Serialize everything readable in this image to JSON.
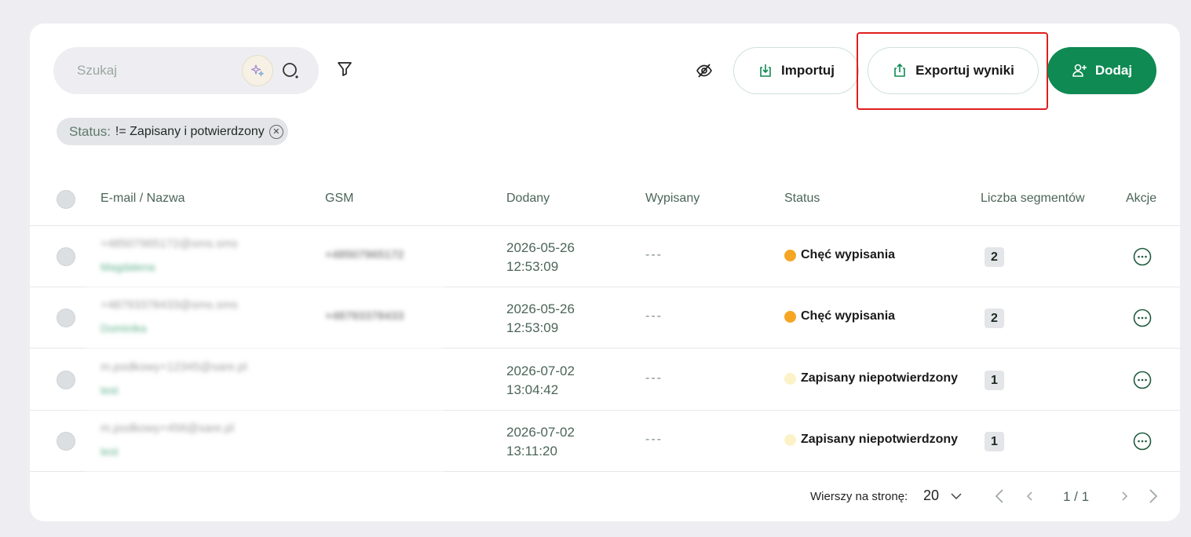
{
  "toolbar": {
    "search_placeholder": "Szukaj",
    "import_label": "Importuj",
    "export_label": "Exportuj wyniki",
    "add_label": "Dodaj"
  },
  "filter_chip": {
    "key": "Status:",
    "value": "!= Zapisany i potwierdzony"
  },
  "table": {
    "columns": [
      "E-mail / Nazwa",
      "GSM",
      "Dodany",
      "Wypisany",
      "Status",
      "Liczba segmentów",
      "Akcje"
    ],
    "rows": [
      {
        "email": "+48507965172@sms.sms",
        "name": "Magdalena",
        "gsm": "+48507965172",
        "added_date": "2026-05-26",
        "added_time": "12:53:09",
        "unsubscribed": "---",
        "status": "Chęć wypisania",
        "status_color": "#f5a623",
        "segments": "2"
      },
      {
        "email": "+48793378433@sms.sms",
        "name": "Dominika",
        "gsm": "+48793378433",
        "added_date": "2026-05-26",
        "added_time": "12:53:09",
        "unsubscribed": "---",
        "status": "Chęć wypisania",
        "status_color": "#f5a623",
        "segments": "2"
      },
      {
        "email": "m.podkowy+12345@sare.pl",
        "name": "test",
        "gsm": "",
        "added_date": "2026-07-02",
        "added_time": "13:04:42",
        "unsubscribed": "---",
        "status": "Zapisany niepotwierdzony",
        "status_color": "#fbf3c7",
        "segments": "1"
      },
      {
        "email": "m.podkowy+456@sare.pl",
        "name": "test",
        "gsm": "",
        "added_date": "2026-07-02",
        "added_time": "13:11:20",
        "unsubscribed": "---",
        "status": "Zapisany niepotwierdzony",
        "status_color": "#fbf3c7",
        "segments": "1"
      }
    ]
  },
  "pagination": {
    "rows_per_page_label": "Wierszy na stronę:",
    "rows_per_page": "20",
    "position": "1 / 1"
  },
  "colors": {
    "accent": "#0e8a52",
    "highlight": "#e01e1e"
  }
}
